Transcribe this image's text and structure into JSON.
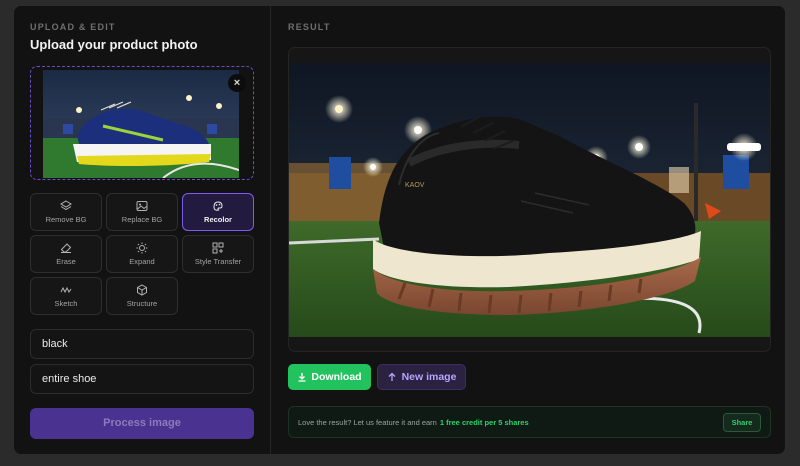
{
  "left_panel": {
    "section_label": "UPLOAD & EDIT",
    "title": "Upload your product photo",
    "close_glyph": "×",
    "tools": [
      {
        "label": "Remove BG",
        "icon": "layers-icon",
        "active": false
      },
      {
        "label": "Replace BG",
        "icon": "image-icon",
        "active": false
      },
      {
        "label": "Recolor",
        "icon": "palette-icon",
        "active": true
      },
      {
        "label": "Erase",
        "icon": "eraser-icon",
        "active": false
      },
      {
        "label": "Expand",
        "icon": "expand-sun-icon",
        "active": false
      },
      {
        "label": "Style Transfer",
        "icon": "grid-plus-icon",
        "active": false
      },
      {
        "label": "Sketch",
        "icon": "squiggle-icon",
        "active": false
      },
      {
        "label": "Structure",
        "icon": "cube-icon",
        "active": false
      }
    ],
    "color_value": "black",
    "target_value": "entire shoe",
    "process_label": "Process image"
  },
  "right_panel": {
    "section_label": "RESULT",
    "download_label": "Download",
    "new_image_label": "New image",
    "promo_text": "Love the result? Let us feature it and earn",
    "promo_highlight": "1 free credit per 5 shares",
    "share_label": "Share"
  },
  "colors": {
    "accent_purple": "#7c5cf2",
    "accent_green": "#22c35e",
    "panel_bg": "#121212"
  }
}
